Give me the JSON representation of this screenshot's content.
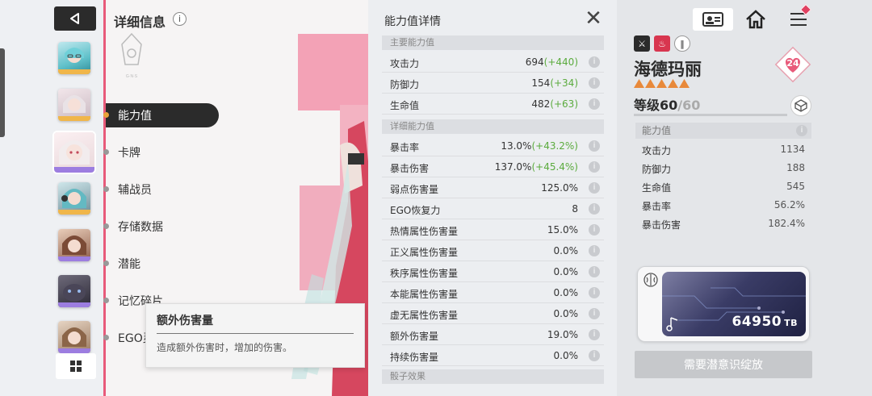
{
  "header": {
    "title": "详细信息",
    "info_icon": "i"
  },
  "nav": {
    "back_icon": "back-triangle-icon",
    "menu": [
      {
        "label": "能力值",
        "active": true
      },
      {
        "label": "卡牌",
        "active": false
      },
      {
        "label": "辅战员",
        "active": false
      },
      {
        "label": "存储数据",
        "active": false
      },
      {
        "label": "潜能",
        "active": false
      },
      {
        "label": "记忆碎片",
        "active": false
      },
      {
        "label": "EGO灵",
        "active": false
      }
    ]
  },
  "tooltip": {
    "title": "额外伤害量",
    "description": "造成额外伤害时，增加的伤害。"
  },
  "detail_panel": {
    "title": "能力值详情",
    "main_section": "主要能力值",
    "main_stats": [
      {
        "label": "攻击力",
        "value": "694",
        "bonus": "(+440)"
      },
      {
        "label": "防御力",
        "value": "154",
        "bonus": "(+34)"
      },
      {
        "label": "生命值",
        "value": "482",
        "bonus": "(+63)"
      }
    ],
    "detail_section": "详细能力值",
    "detail_stats": [
      {
        "label": "暴击率",
        "value": "13.0%",
        "bonus": "(+43.2%)"
      },
      {
        "label": "暴击伤害",
        "value": "137.0%",
        "bonus": "(+45.4%)"
      },
      {
        "label": "弱点伤害量",
        "value": "125.0%",
        "bonus": ""
      },
      {
        "label": "EGO恢复力",
        "value": "8",
        "bonus": ""
      },
      {
        "label": "热情属性伤害量",
        "value": "15.0%",
        "bonus": ""
      },
      {
        "label": "正义属性伤害量",
        "value": "0.0%",
        "bonus": ""
      },
      {
        "label": "秩序属性伤害量",
        "value": "0.0%",
        "bonus": ""
      },
      {
        "label": "本能属性伤害量",
        "value": "0.0%",
        "bonus": ""
      },
      {
        "label": "虚无属性伤害量",
        "value": "0.0%",
        "bonus": ""
      },
      {
        "label": "额外伤害量",
        "value": "19.0%",
        "bonus": ""
      },
      {
        "label": "持续伤害量",
        "value": "0.0%",
        "bonus": ""
      }
    ],
    "dice_section": "骰子效果"
  },
  "character": {
    "name": "海德玛丽",
    "stars": 5,
    "level_label": "等级",
    "level": "60",
    "level_max": "/60",
    "affection": "24",
    "stats_section": "能力值",
    "stats": [
      {
        "label": "攻击力",
        "value": "1134"
      },
      {
        "label": "防御力",
        "value": "188"
      },
      {
        "label": "生命值",
        "value": "545"
      },
      {
        "label": "暴击率",
        "value": "56.2%"
      },
      {
        "label": "暴击伤害",
        "value": "182.4%"
      }
    ],
    "storage_value": "64950",
    "storage_unit": "TB",
    "release_button": "需要潜意识绽放"
  },
  "colors": {
    "accent_pink": "#e85a7a",
    "bonus_green": "#5bab3e",
    "star_orange": "#e8893a"
  }
}
